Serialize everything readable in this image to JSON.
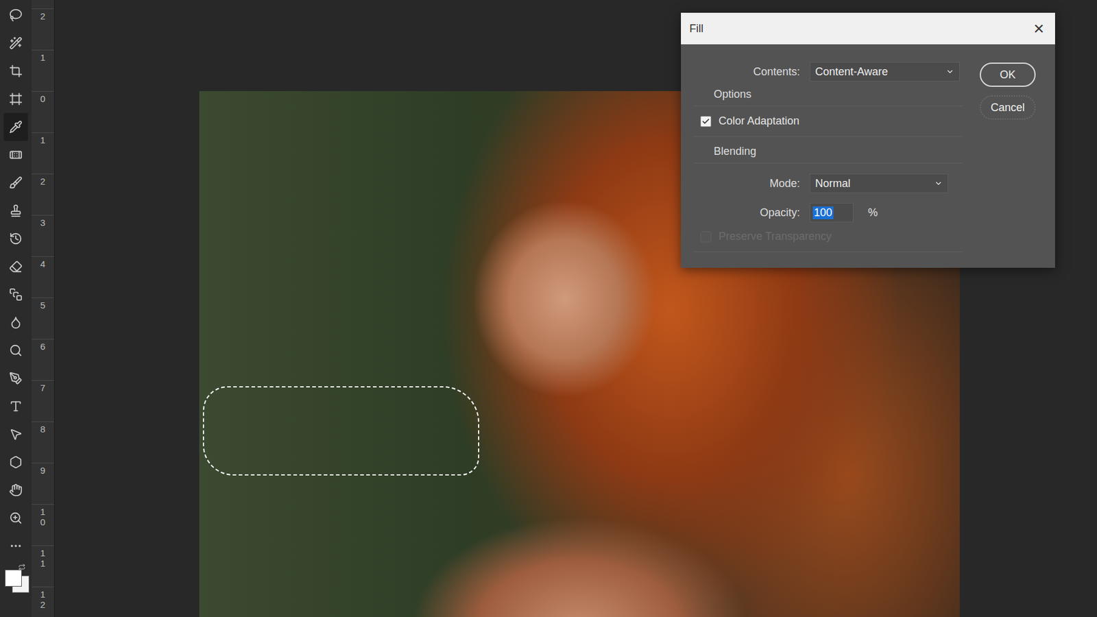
{
  "ruler": {
    "numbers": [
      "2",
      "1",
      "0",
      "1",
      "2",
      "3",
      "4",
      "5",
      "6",
      "7",
      "8",
      "9",
      "10",
      "11",
      "12"
    ]
  },
  "dialog": {
    "title": "Fill",
    "close": "×",
    "contents": {
      "label": "Contents:",
      "value": "Content-Aware"
    },
    "options": {
      "label": "Options",
      "colorAdaptation": {
        "label": "Color Adaptation",
        "checked": true
      }
    },
    "blending": {
      "label": "Blending",
      "mode": {
        "label": "Mode:",
        "value": "Normal"
      },
      "opacity": {
        "label": "Opacity:",
        "value": "100",
        "unit": "%",
        "selected": true
      },
      "preserveTransparency": {
        "label": "Preserve Transparency",
        "checked": false,
        "disabled": true
      }
    },
    "buttons": [
      {
        "label": "OK",
        "default": true
      },
      {
        "label": "Cancel",
        "default": false
      }
    ]
  }
}
